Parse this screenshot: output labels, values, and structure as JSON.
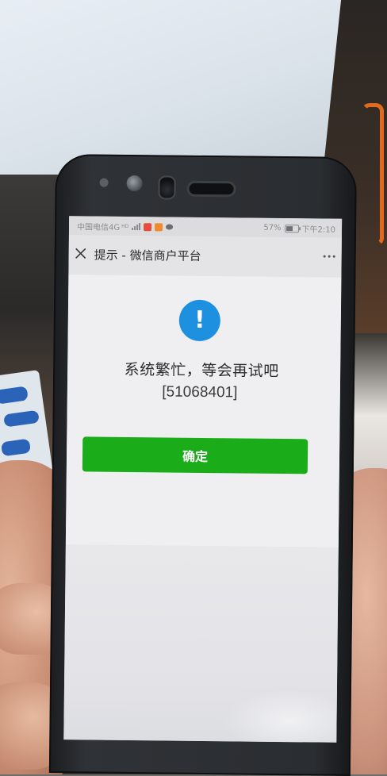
{
  "status_bar": {
    "carrier": "中国电信4G",
    "network_sup": "HD",
    "battery": "57%",
    "battery_level": 0.57,
    "time": "下午2:10"
  },
  "nav": {
    "title": "提示 - 微信商户平台"
  },
  "dialog": {
    "icon": "!",
    "message": "系统繁忙，等会再试吧",
    "code": "[51068401]",
    "confirm_label": "确定"
  },
  "colors": {
    "confirm_button": "#1aad19",
    "alert_icon": "#1e90e0",
    "badge_orange": "#f08a2b",
    "badge_red": "#e84b3c"
  },
  "icons": {
    "close": "close-icon",
    "more": "more-dots-icon",
    "alert": "exclamation-icon",
    "signal": "signal-icon",
    "battery": "battery-icon"
  }
}
